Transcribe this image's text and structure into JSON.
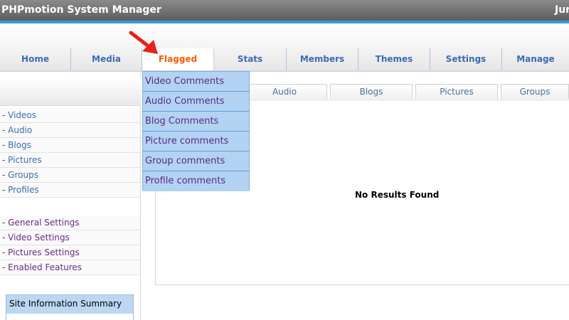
{
  "app": {
    "title": "PHPmotion System Manager",
    "date": "Jun"
  },
  "nav": {
    "tabs": [
      {
        "label": "Home",
        "active": false
      },
      {
        "label": "Media",
        "active": false
      },
      {
        "label": "Flagged",
        "active": true
      },
      {
        "label": "Stats",
        "active": false
      },
      {
        "label": "Members",
        "active": false
      },
      {
        "label": "Themes",
        "active": false
      },
      {
        "label": "Settings",
        "active": false
      },
      {
        "label": "Manage",
        "active": false
      }
    ]
  },
  "flagged_menu": {
    "items": [
      "Video Comments",
      "Audio Comments",
      "Blog Comments",
      "Picture comments",
      "Group comments",
      "Profile comments"
    ]
  },
  "sidebar": {
    "media": [
      {
        "prefix": "- ",
        "label": "Videos"
      },
      {
        "prefix": "- ",
        "label": "Audio"
      },
      {
        "prefix": "- ",
        "label": "Blogs"
      },
      {
        "prefix": "- ",
        "label": "Pictures"
      },
      {
        "prefix": "- ",
        "label": "Groups"
      },
      {
        "prefix": "- ",
        "label": "Profiles"
      }
    ],
    "settings": [
      {
        "prefix": "- ",
        "label": "General Settings"
      },
      {
        "prefix": "- ",
        "label": "Video Settings"
      },
      {
        "prefix": "- ",
        "label": "Pictures Settings"
      },
      {
        "prefix": "- ",
        "label": "Enabled Features"
      }
    ],
    "summary_title": "Site Information Summary"
  },
  "content": {
    "subtabs": [
      "Audio",
      "Blogs",
      "Pictures",
      "Groups"
    ],
    "empty_message": "No Results Found"
  },
  "colors": {
    "accent_blue": "#3d9bd6",
    "active_tab": "#ff5a00",
    "nav_link": "#3b6bb5",
    "menu_bg": "#b3d3f3",
    "arrow": "#e8211a"
  },
  "icons": {
    "pointer": "red-arrow-icon"
  }
}
